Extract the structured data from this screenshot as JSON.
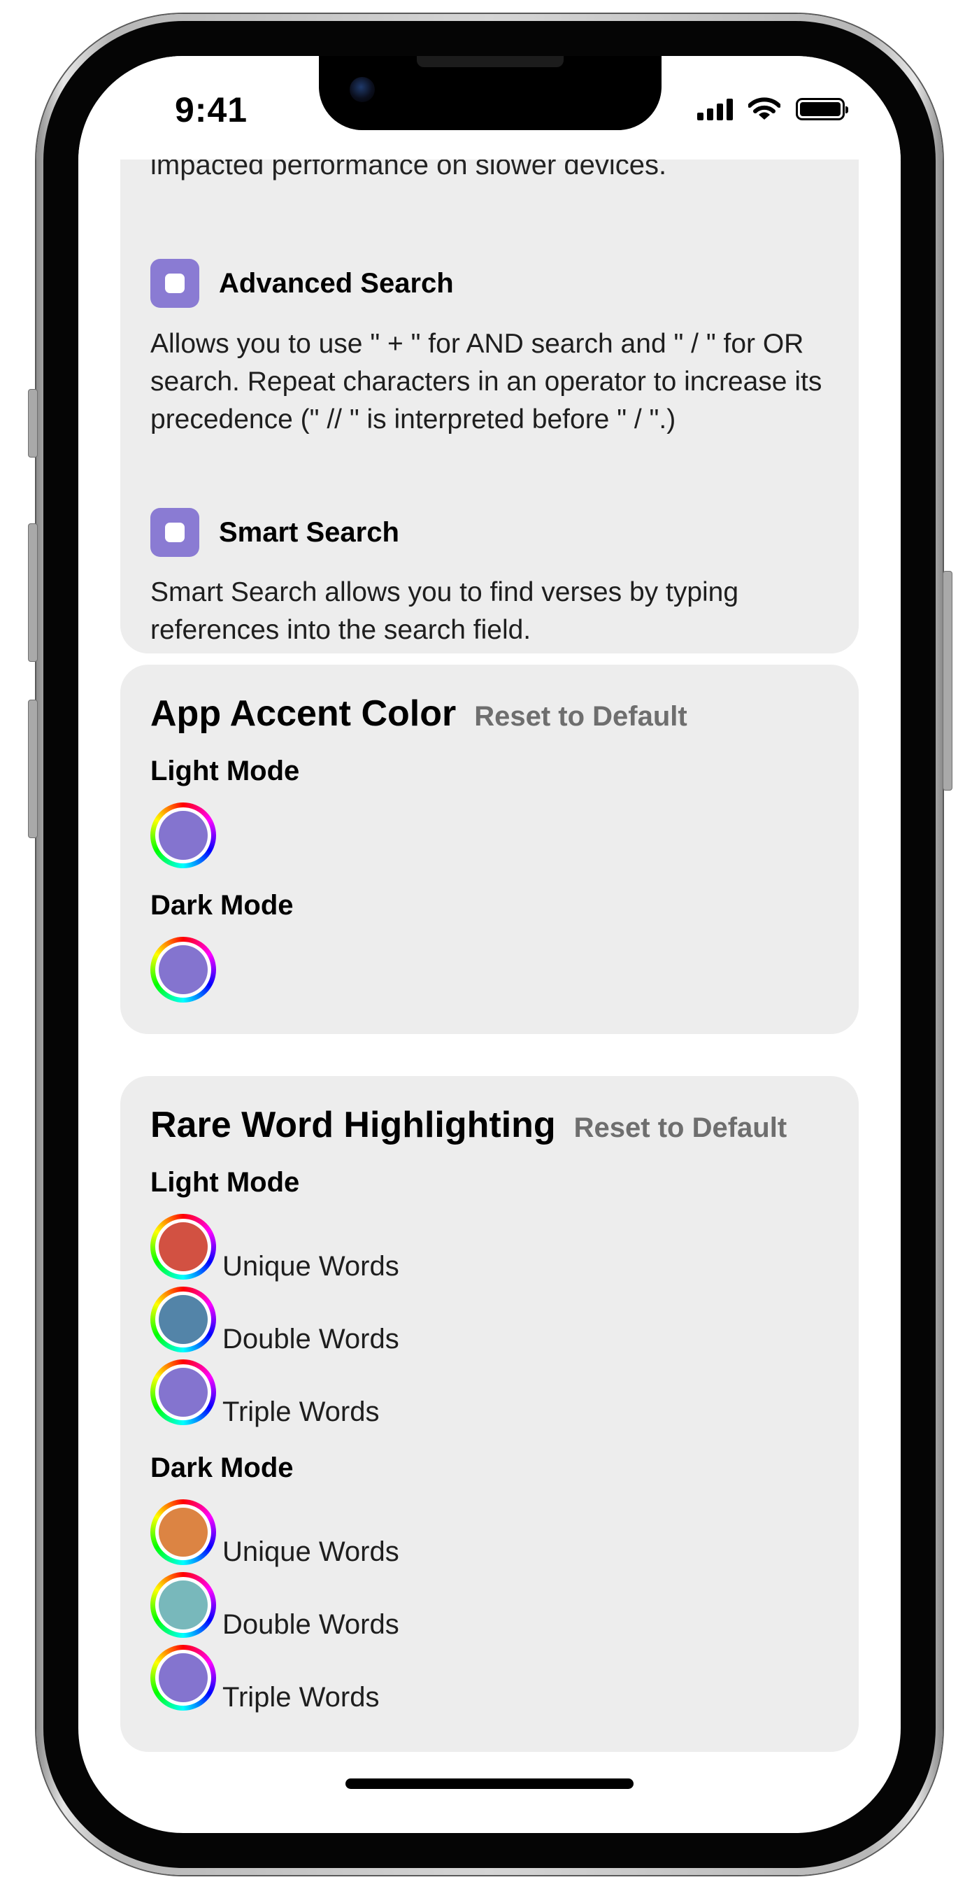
{
  "status_bar": {
    "time": "9:41"
  },
  "search_options": {
    "clipped_text": "impacted performance on slower devices.",
    "advanced_search": {
      "label": "Advanced Search",
      "description": "Allows you to use \" + \" for AND search and \" / \" for OR search. Repeat characters in an operator to increase its precedence (\" // \" is interpreted before \" / \".)"
    },
    "smart_search": {
      "label": "Smart Search",
      "description": "Smart Search allows you to find verses by typing references into the search field."
    }
  },
  "app_accent_color": {
    "title": "App Accent Color",
    "reset_label": "Reset to Default",
    "light_mode_label": "Light Mode",
    "dark_mode_label": "Dark Mode",
    "light_color": "#8474cf",
    "dark_color": "#8474cf"
  },
  "rare_word_highlighting": {
    "title": "Rare Word Highlighting",
    "reset_label": "Reset to Default",
    "light_mode_label": "Light Mode",
    "dark_mode_label": "Dark Mode",
    "light": [
      {
        "label": "Unique Words",
        "color": "#d25142"
      },
      {
        "label": "Double Words",
        "color": "#5384a8"
      },
      {
        "label": "Triple Words",
        "color": "#8474cf"
      }
    ],
    "dark": [
      {
        "label": "Unique Words",
        "color": "#dc8443"
      },
      {
        "label": "Double Words",
        "color": "#78b8bb"
      },
      {
        "label": "Triple Words",
        "color": "#8474cf"
      }
    ]
  },
  "colors": {
    "checkbox_accent": "#8a7bd3",
    "card_background": "#ededed",
    "reset_link": "#6e6e6e"
  }
}
